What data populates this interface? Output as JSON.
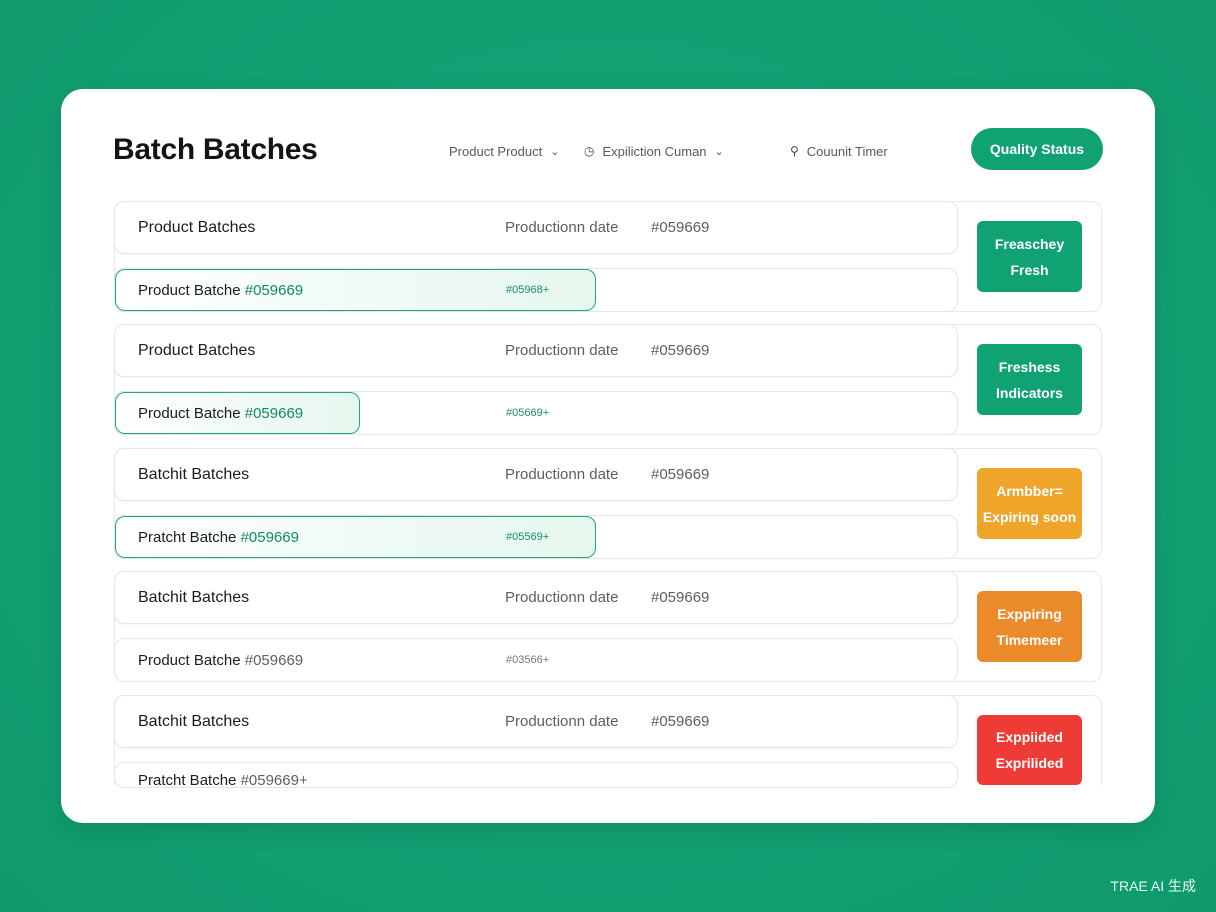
{
  "header": {
    "title": "Batch Batches",
    "filters": [
      {
        "label": "Product Product",
        "icon": "",
        "chevron": true
      },
      {
        "label": "Expiliction Cuman",
        "icon": "timer-icon",
        "chevron": true
      },
      {
        "label": "Couunit Timer",
        "icon": "pin-icon",
        "chevron": false
      }
    ],
    "quality_button": "Quality Status"
  },
  "batches": [
    {
      "name": "Product Batches",
      "date_label": "Productionn date",
      "code": "#059669",
      "row2_prefix": "Product Batche",
      "row2_code": "#059669",
      "row2_small": "#05968+",
      "progress": 0.57,
      "badge_line1": "Freaschey",
      "badge_line2": "Fresh",
      "badge_color": "#11a273"
    },
    {
      "name": "Product Batches",
      "date_label": "Productionn date",
      "code": "#059669",
      "row2_prefix": "Product Batche",
      "row2_code": "#059669",
      "row2_small": "#05669+",
      "progress": 0.29,
      "badge_line1": "Freshess",
      "badge_line2": "Indicators",
      "badge_color": "#11a273"
    },
    {
      "name": "Batchit Batches",
      "date_label": "Productionn date",
      "code": "#059669",
      "row2_prefix": "Pratcht Batche",
      "row2_code": "#059669",
      "row2_small": "#05569+",
      "progress": 0.57,
      "badge_line1": "Armbber=",
      "badge_line2": "Expiring soon",
      "badge_color": "#efa42a"
    },
    {
      "name": "Batchit Batches",
      "date_label": "Productionn date",
      "code": "#059669",
      "row2_prefix": "Product Batche",
      "row2_code": "#059669",
      "row2_small": "#03566+",
      "progress": 0,
      "badge_line1": "Exppiring",
      "badge_line2": "Timemeer",
      "badge_color": "#ea8a2a"
    },
    {
      "name": "Batchit Batches",
      "date_label": "Productionn date",
      "code": "#059669",
      "row2_prefix": "Pratcht Batche",
      "row2_code": "#059669+",
      "row2_small": "",
      "progress": 0,
      "badge_line1": "Exppiided",
      "badge_line2": "Exprilided",
      "badge_color": "#ee3b36"
    }
  ],
  "watermark": "TRAE AI 生成"
}
